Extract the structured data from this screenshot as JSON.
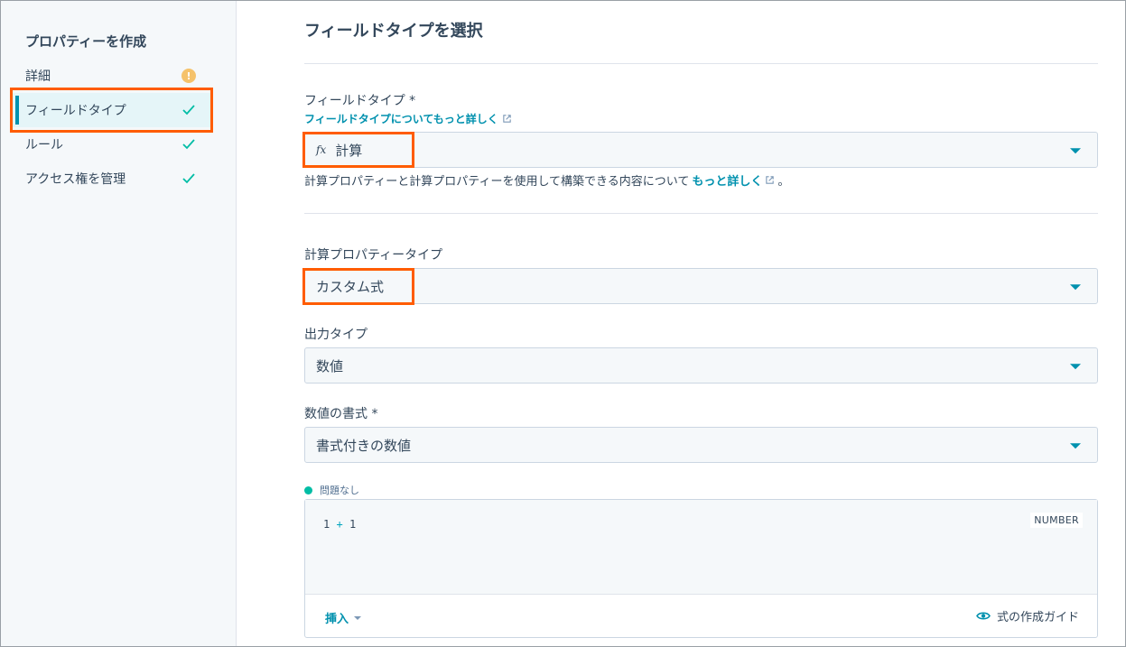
{
  "sidebar": {
    "title": "プロパティーを作成",
    "items": [
      {
        "label": "詳細",
        "status": "warning",
        "status_symbol": "!"
      },
      {
        "label": "フィールドタイプ",
        "status": "done",
        "active": true
      },
      {
        "label": "ルール",
        "status": "done"
      },
      {
        "label": "アクセス権を管理",
        "status": "done"
      }
    ]
  },
  "main": {
    "title": "フィールドタイプを選択",
    "field_type": {
      "label": "フィールドタイプ *",
      "link": "フィールドタイプについてもっと詳しく",
      "icon": "fx",
      "value": "計算",
      "help_text": "計算プロパティーと計算プロパティーを使用して構築できる内容について",
      "help_link": "もっと詳しく",
      "help_suffix": "。"
    },
    "calc_type": {
      "label": "計算プロパティータイプ",
      "value": "カスタム式"
    },
    "output_type": {
      "label": "出力タイプ",
      "value": "数値"
    },
    "number_format": {
      "label": "数値の書式 *",
      "value": "書式付きの数値"
    },
    "editor": {
      "status": "問題なし",
      "code_left": "1",
      "code_op": "+",
      "code_right": "1",
      "type_badge": "NUMBER",
      "insert_label": "挿入",
      "guide_label": "式の作成ガイド"
    }
  },
  "colors": {
    "accent": "#0091ae",
    "highlight": "#ff5c00",
    "success": "#00bda5",
    "warning": "#f5c26b"
  }
}
